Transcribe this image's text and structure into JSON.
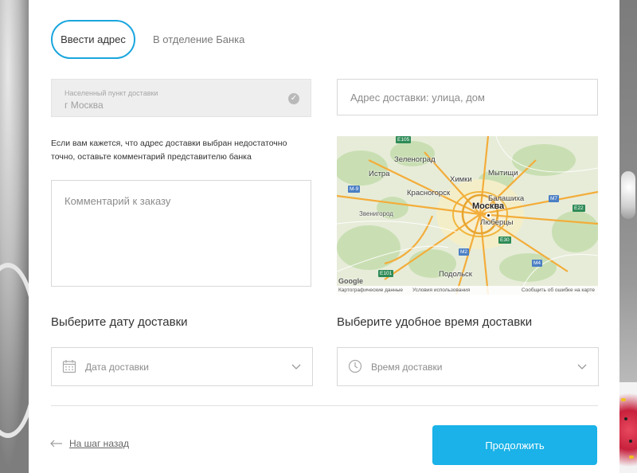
{
  "tabs": {
    "active": "Ввести адрес",
    "inactive": "В отделение Банка"
  },
  "locality": {
    "label": "Населенный пункт доставки",
    "value": "г Москва",
    "check_icon": "check-circle-icon"
  },
  "address": {
    "placeholder": "Адрес доставки: улица, дом"
  },
  "note": "Если вам кажется, что адрес доставки выбран недостаточно точно, оставьте комментарий представителю банка",
  "comment": {
    "placeholder": "Комментарий к заказу"
  },
  "map": {
    "labels": {
      "zelenograd": "Зеленоград",
      "khimki": "Химки",
      "mytishchi": "Мытищи",
      "istra": "Истра",
      "krasnogorsk": "Красногорск",
      "balashikha": "Балашиха",
      "moskva": "Москва",
      "lyubertsy": "Люберцы",
      "zvenigorod": "Звенигород",
      "podolsk": "Подольск"
    },
    "roads": {
      "e105": "E105",
      "m9": "M-9",
      "m7": "M7",
      "e22": "E22",
      "e30": "E30",
      "m4": "M4",
      "m2": "M2",
      "e101": "E101"
    },
    "footer": {
      "data": "Картографические данные",
      "terms": "Условия использования",
      "report": "Сообщить об ошибке на карте"
    }
  },
  "delivery_date": {
    "title": "Выберите дату доставки",
    "placeholder": "Дата доставки",
    "icon": "calendar-icon"
  },
  "delivery_time": {
    "title": "Выберите удобное время доставки",
    "placeholder": "Время доставки",
    "icon": "clock-icon"
  },
  "actions": {
    "back": "На шаг назад",
    "continue": "Продолжить"
  },
  "colors": {
    "accent": "#1ab2e8",
    "tab_border": "#1aa6de"
  }
}
